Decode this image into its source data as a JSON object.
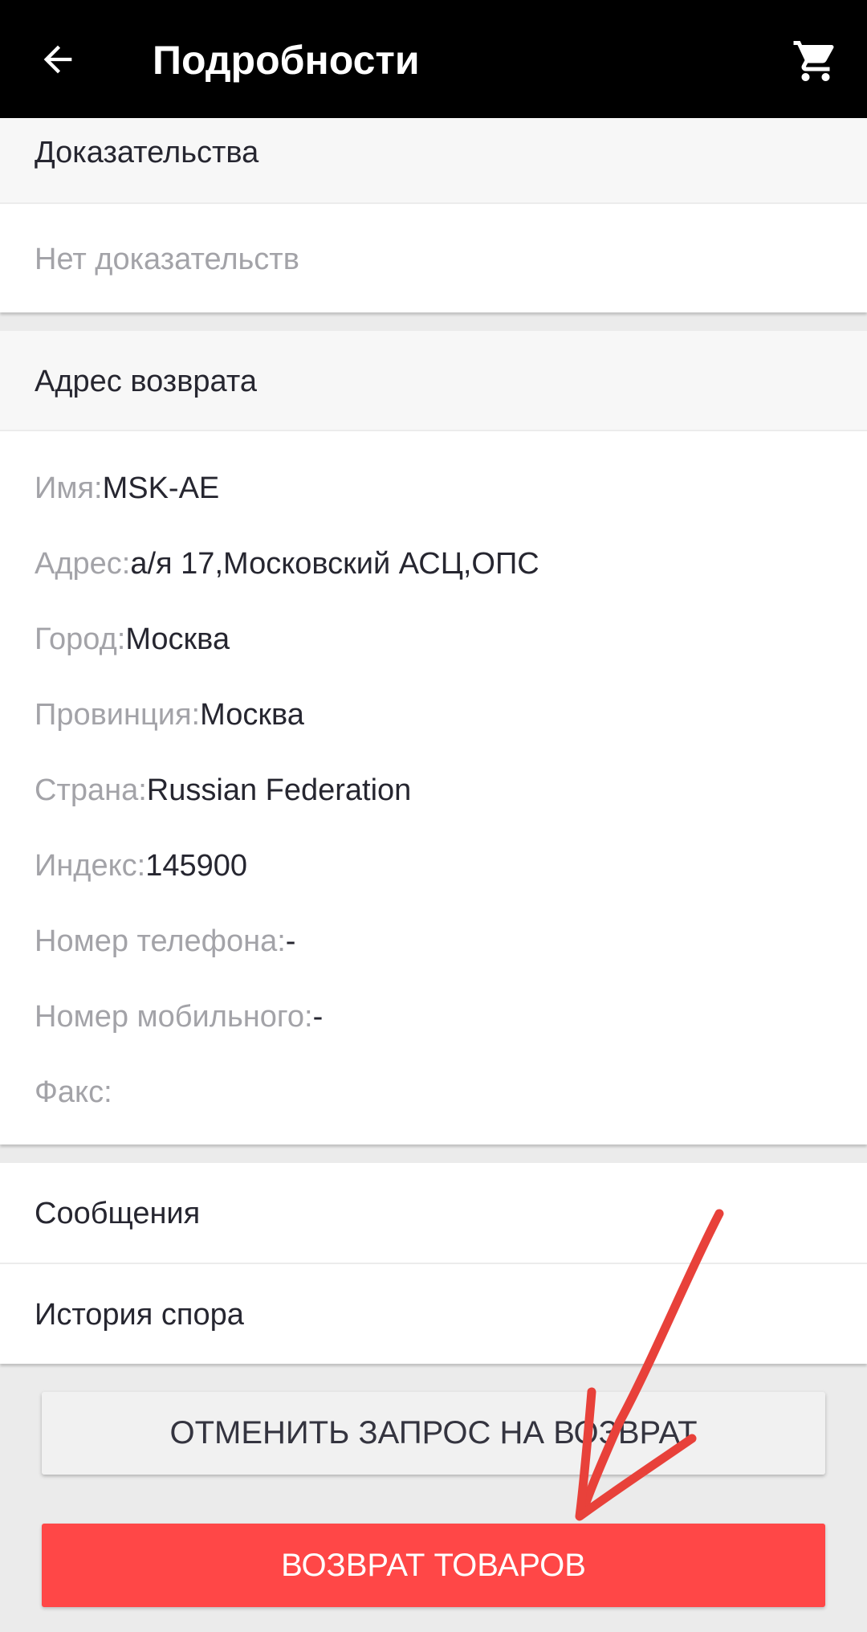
{
  "header": {
    "title": "Подробности",
    "back_icon": "arrow-back-icon",
    "cart_icon": "shopping-cart-icon"
  },
  "evidence": {
    "title": "Доказательства",
    "empty_text": "Нет доказательств"
  },
  "return_address": {
    "title": "Адрес возврата",
    "rows": [
      {
        "label": "Имя:",
        "value": "MSK-AE"
      },
      {
        "label": "Адрес:",
        "value": "а/я 17,Московский АСЦ,ОПС"
      },
      {
        "label": "Город:",
        "value": "Москва"
      },
      {
        "label": "Провинция:",
        "value": "Москва"
      },
      {
        "label": "Страна:",
        "value": "Russian Federation"
      },
      {
        "label": "Индекс:",
        "value": "145900"
      },
      {
        "label": "Номер телефона:",
        "value": "-"
      },
      {
        "label": "Номер мобильного:",
        "value": "-"
      },
      {
        "label": "Факс:",
        "value": ""
      }
    ]
  },
  "links": {
    "messages": "Сообщения",
    "dispute_history": "История спора"
  },
  "buttons": {
    "cancel_return": "ОТМЕНИТЬ ЗАПРОС НА ВОЗВРАТ",
    "return_goods": "ВОЗВРАТ ТОВАРОВ"
  },
  "colors": {
    "appbar": "#000000",
    "primary_button": "#ff4747",
    "annotation_arrow": "#e8413a"
  }
}
